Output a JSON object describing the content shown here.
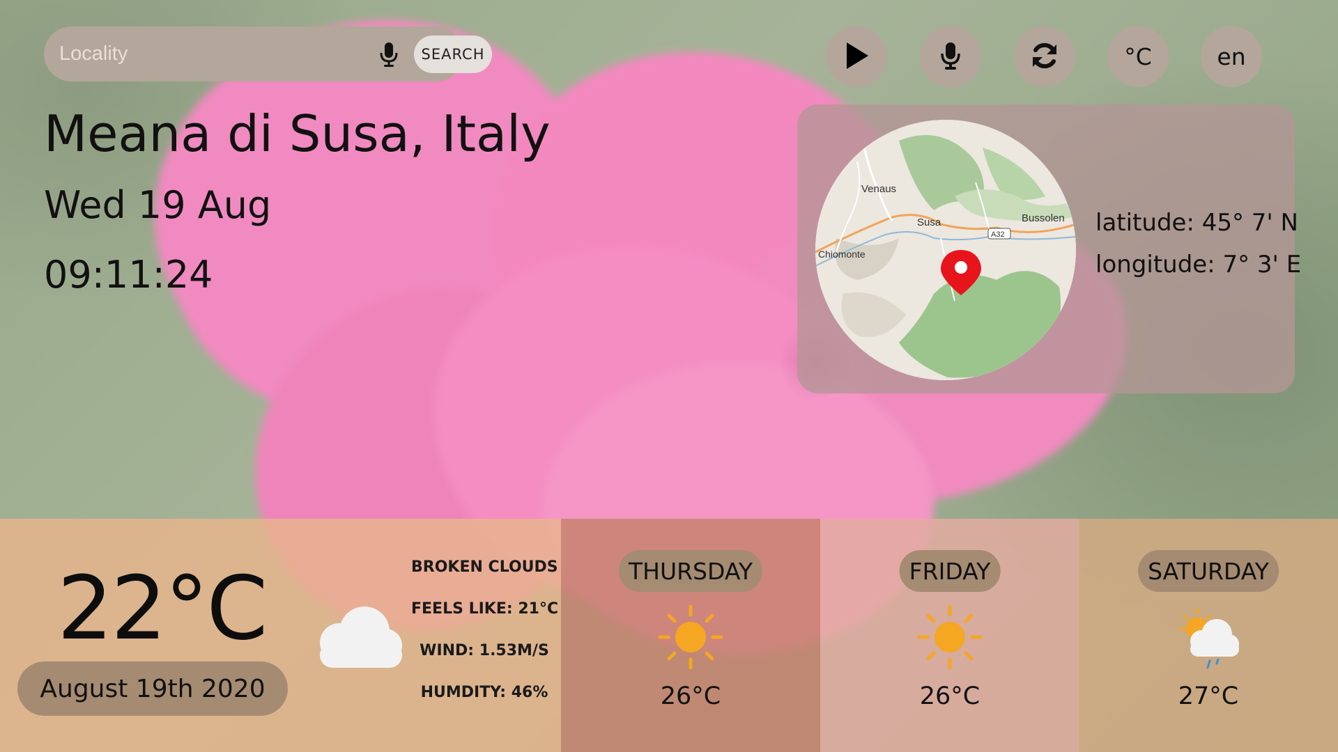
{
  "search": {
    "placeholder": "Locality",
    "button_label": "SEARCH",
    "mic_icon": "microphone-icon"
  },
  "controls": {
    "play_icon": "play-icon",
    "voice_icon": "microphone-icon",
    "refresh_icon": "refresh-icon",
    "unit_label": "°C",
    "language_label": "en"
  },
  "location": {
    "name": "Meana di Susa, Italy",
    "date": "Wed 19 Aug",
    "time": "09:11:24"
  },
  "map": {
    "places": [
      "Venaus",
      "Susa",
      "Bussolen",
      "Chiomonte",
      "A32"
    ],
    "marker_color": "#e8141c",
    "latitude_text": "latitude: 45° 7' N",
    "longitude_text": "longitude: 7° 3' E"
  },
  "current": {
    "temperature": "22°C",
    "date_long": "August 19th 2020",
    "condition": "BROKEN CLOUDS",
    "feels_like": "FEELS LIKE: 21°C",
    "wind": "WIND: 1.53M/S",
    "humidity": "HUMDITY: 46%",
    "icon": "cloud-icon"
  },
  "forecast": [
    {
      "day": "THURSDAY",
      "temp": "26°C",
      "icon": "sun-icon"
    },
    {
      "day": "FRIDAY",
      "temp": "26°C",
      "icon": "sun-icon"
    },
    {
      "day": "SATURDAY",
      "temp": "27°C",
      "icon": "sun-cloud-rain-icon"
    }
  ],
  "colors": {
    "sun": "#f5a623",
    "pill": "#a58b72",
    "control_bg": "#b4a69a"
  }
}
